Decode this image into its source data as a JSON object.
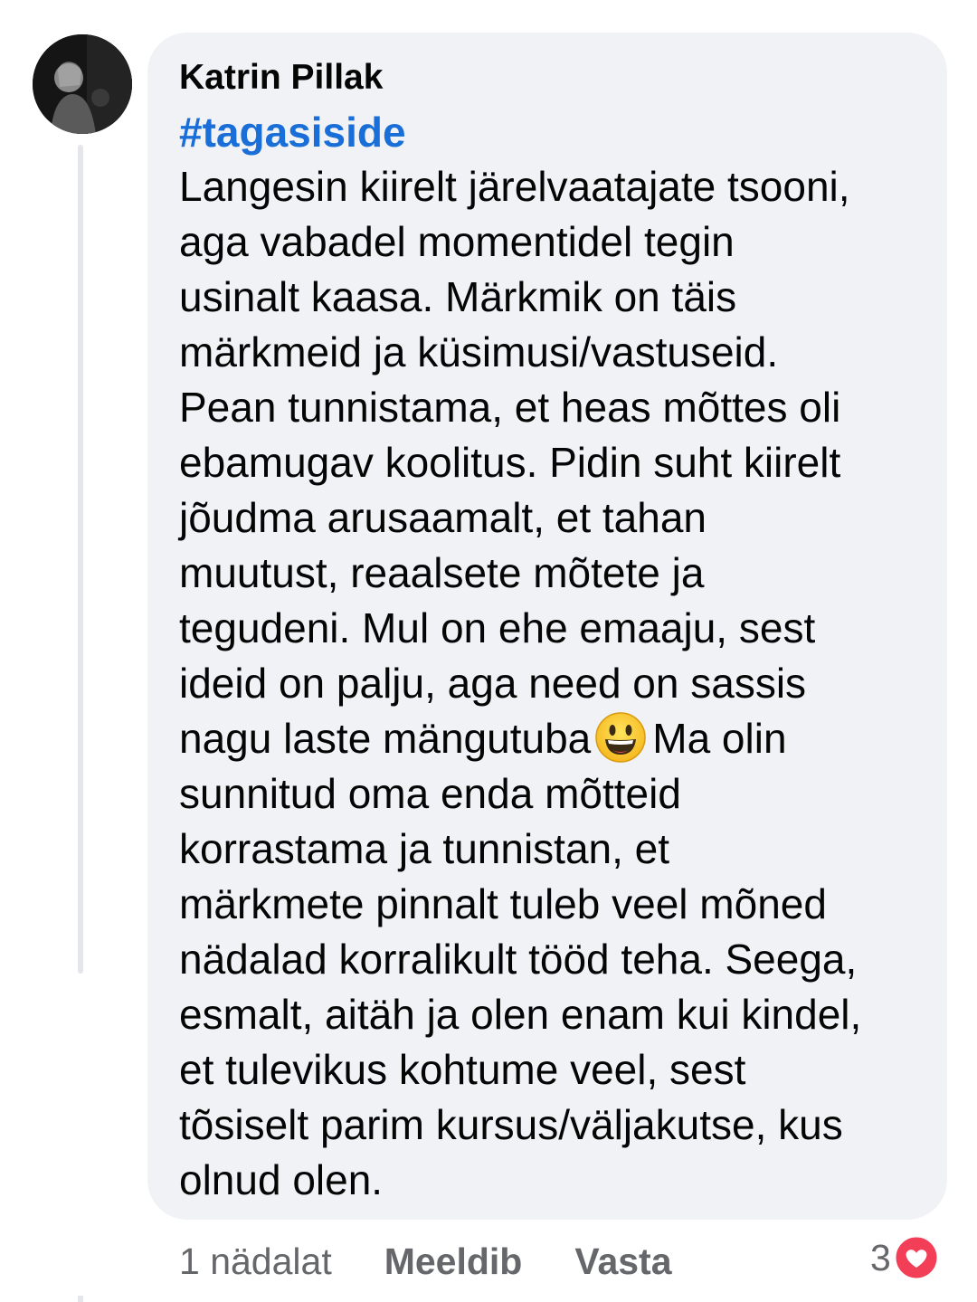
{
  "comment": {
    "author": "Katrin Pillak",
    "hashtag": "#tagasiside",
    "lines": [
      "Langesin kiirelt järelvaatajate tsooni,",
      "aga vabadel momentidel tegin",
      "usinalt kaasa. Märkmik on täis",
      "märkmeid ja küsimusi/vastuseid.",
      "Pean tunnistama, et heas mõttes oli",
      "ebamugav koolitus. Pidin suht kiirelt",
      "jõudma arusaamalt, et tahan",
      "muutust, reaalsete mõtete ja",
      "tegudeni. Mul on ehe emaaju, sest",
      "ideid on palju, aga need on sassis",
      "nagu laste mängutuba",
      "Ma olin",
      "sunnitud oma enda mõtteid",
      "korrastama ja tunnistan, et",
      "märkmete pinnalt tuleb veel mõned",
      "nädalad korralikult tööd teha. Seega,",
      "esmalt, aitäh ja olen enam kui kindel,",
      "et tulevikus kohtume veel, sest",
      "tõsiselt parim kursus/väljakutse, kus",
      "olnud olen."
    ],
    "emoji_icon": "grinning-face-icon"
  },
  "actions": {
    "time": "1 nädalat",
    "like_label": "Meeldib",
    "reply_label": "Vasta"
  },
  "reactions": {
    "count": "3",
    "icon": "heart-reaction-icon",
    "color": "#f33e58"
  },
  "colors": {
    "bubble": "#f0f2f5",
    "hashtag": "#1a6ed8",
    "secondary_text": "#65676b"
  }
}
